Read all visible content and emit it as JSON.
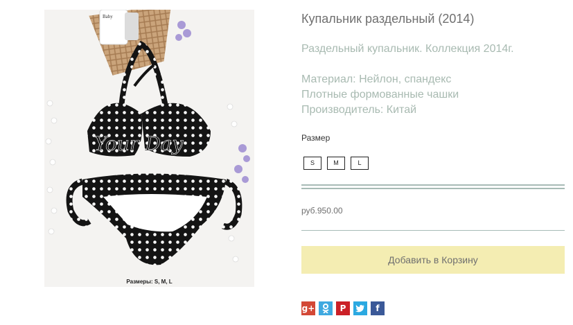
{
  "product": {
    "title": "Купальник раздельный (2014)",
    "subtitle": "Раздельный купальник. Коллекция 2014г.",
    "features": [
      "Материал: Нейлон, спандекс",
      "Плотные формованные чашки",
      "Производитель: Китай"
    ],
    "image_caption": "Размеры: S, M, L",
    "image_watermark": "Your Day",
    "image_bottle_text": "Baby"
  },
  "size": {
    "label": "Размер",
    "options": [
      "S",
      "M",
      "L"
    ]
  },
  "price": "руб.950.00",
  "cart": {
    "add_label": "Добавить в Корзину"
  },
  "social": [
    {
      "name": "google-plus-icon",
      "glyph": "g+",
      "color": "#d34836"
    },
    {
      "name": "odnoklassniki-icon",
      "glyph": "",
      "color": "#3fa9e0"
    },
    {
      "name": "pinterest-icon",
      "glyph": "P",
      "color": "#cb2027"
    },
    {
      "name": "twitter-icon",
      "glyph": "",
      "color": "#2ba9e1"
    },
    {
      "name": "facebook-icon",
      "glyph": "f",
      "color": "#3b5998"
    }
  ],
  "colors": {
    "title": "#6f6f6f",
    "muted_green": "#a8bab1",
    "divider": "#a7bbb6",
    "cart_button": "#f4edb2"
  }
}
